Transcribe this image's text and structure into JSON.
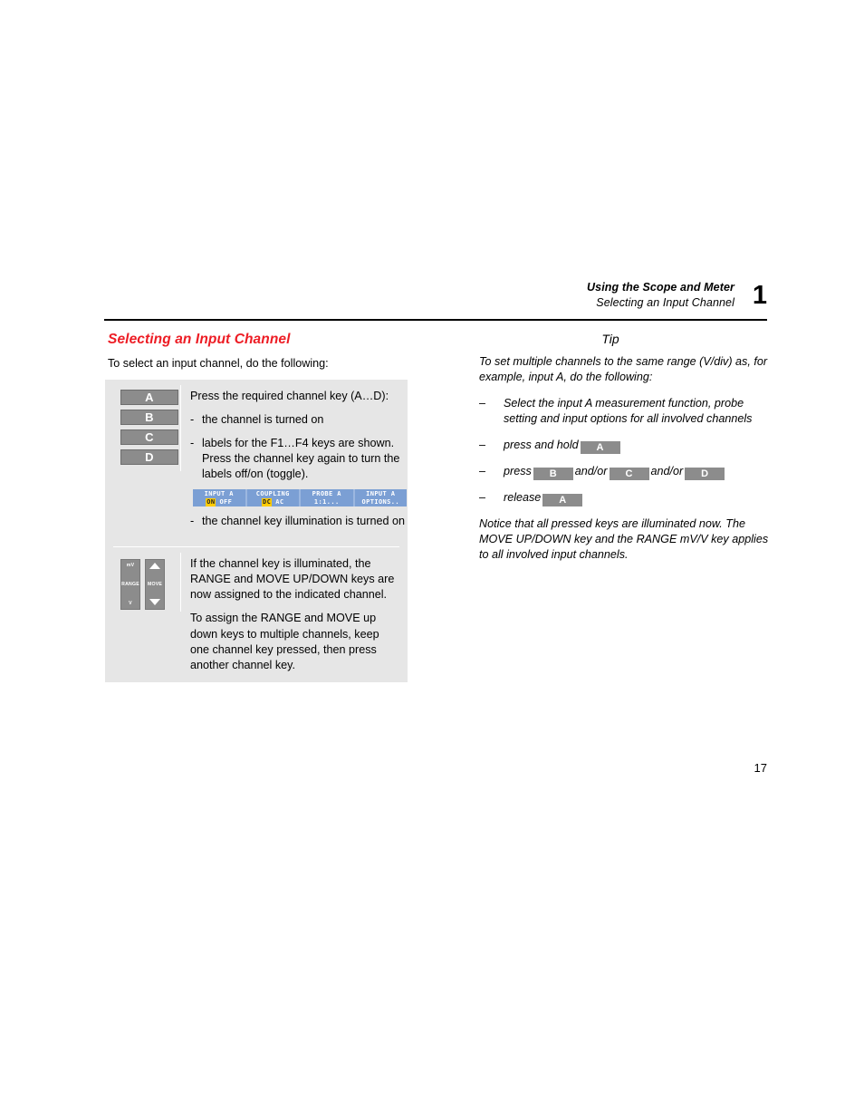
{
  "header": {
    "chapter_title": "Using the Scope and Meter",
    "section_title": "Selecting an Input Channel",
    "chapter_number": "1"
  },
  "page_number": "17",
  "left_column": {
    "heading": "Selecting an Input Channel",
    "heading_color": "#ed1c24",
    "intro": "To select an input channel, do the following:",
    "procedure": {
      "section1": {
        "channel_keys": [
          "A",
          "B",
          "C",
          "D"
        ],
        "lead_text": "Press the required channel key (A…D):",
        "bullets": [
          {
            "marker": "-",
            "text": "the channel is turned on"
          },
          {
            "marker": "-",
            "text": "labels for the F1…F4 keys are shown. Press the channel key again to turn the labels off/on (toggle)."
          }
        ],
        "softkeys": [
          {
            "title": "INPUT A",
            "options": [
              {
                "label": "ON",
                "selected": true
              },
              {
                "label": "OFF",
                "selected": false
              }
            ]
          },
          {
            "title": "COUPLING",
            "options": [
              {
                "label": "DC",
                "selected": true
              },
              {
                "label": "AC",
                "selected": false
              }
            ]
          },
          {
            "title": "PROBE A",
            "options": [
              {
                "label": "1:1...",
                "selected": false
              }
            ]
          },
          {
            "title": "INPUT A",
            "options": [
              {
                "label": "OPTIONS..",
                "selected": false
              }
            ]
          }
        ],
        "bullet_after_softkeys": {
          "marker": "-",
          "text": "the channel key illumination is turned on"
        }
      },
      "section2": {
        "range_key": {
          "top_label": "mV",
          "mid_label": "RANGE",
          "bottom_label": "V"
        },
        "move_key": {
          "mid_label": "MOVE",
          "up_icon": "triangle-up-icon",
          "down_icon": "triangle-down-icon"
        },
        "paragraphs": [
          "If the channel key is illuminated, the RANGE and MOVE UP/DOWN keys are now assigned to the indicated channel.",
          "To assign the RANGE and MOVE up down keys to multiple channels, keep one channel key pressed, then press another channel key."
        ]
      }
    }
  },
  "right_column": {
    "tip_heading": "Tip",
    "tip_intro": "To set multiple channels to the same range (V/div) as, for example, input A, do the following:",
    "steps": [
      {
        "marker": "–",
        "before": "Select the input A measurement function, probe setting and input options for all involved channels",
        "keys": []
      },
      {
        "marker": "–",
        "before": "press and hold",
        "keys": [
          "A"
        ],
        "between": [],
        "after": ""
      },
      {
        "marker": "–",
        "before": "press",
        "keys": [
          "B",
          "C",
          "D"
        ],
        "between": [
          "and/or",
          "and/or"
        ],
        "after": ""
      },
      {
        "marker": "–",
        "before": "release",
        "keys": [
          "A"
        ],
        "between": [],
        "after": ""
      }
    ],
    "closing": "Notice that all pressed keys are illuminated now. The MOVE UP/DOWN key and the RANGE mV/V key applies to all involved input channels."
  }
}
